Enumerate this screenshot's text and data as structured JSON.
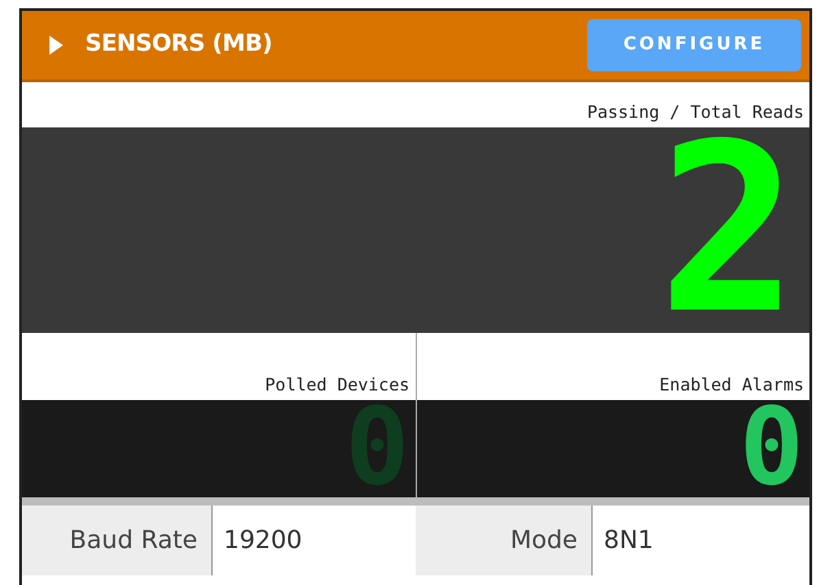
{
  "header": {
    "title": "SENSORS (MB)",
    "expanded": false,
    "button": "CONFIGURE"
  },
  "main_display": {
    "label": "Passing / Total Reads",
    "digit": "2"
  },
  "small_displays": [
    {
      "label": "Polled Devices",
      "digit": "0",
      "lit": false
    },
    {
      "label": "Enabled Alarms",
      "digit": "0",
      "lit": true
    }
  ],
  "fields": [
    {
      "label": "Baud Rate",
      "value": "19200"
    },
    {
      "label": "Mode",
      "value": "8N1"
    }
  ]
}
